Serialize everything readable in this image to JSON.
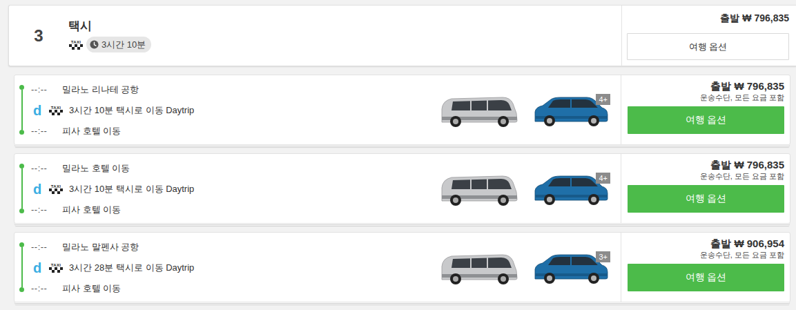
{
  "option": {
    "number": "3",
    "title": "택시",
    "taxi_label": "TAXI",
    "duration": "3시간 10분",
    "price": "출발 ₩ 796,835",
    "button": "여행 옵션"
  },
  "routes": [
    {
      "from_time": "--:--",
      "from": "밀라노 리나테 공항",
      "logo": "d",
      "taxi_label": "TAXI",
      "segment": "3시간 10분 택시로 이동 Daytrip",
      "to_time": "--:--",
      "to": "피사 호텔 이동",
      "capacity": "4+",
      "price": "출발 ₩ 796,835",
      "note": "운송수단, 모든 요금 포함",
      "button": "여행 옵션"
    },
    {
      "from_time": "--:--",
      "from": "밀라노 호텔 이동",
      "logo": "d",
      "taxi_label": "TAXI",
      "segment": "3시간 10분 택시로 이동 Daytrip",
      "to_time": "--:--",
      "to": "피사 호텔 이동",
      "capacity": "4+",
      "price": "출발 ₩ 796,835",
      "note": "운송수단, 모든 요금 포함",
      "button": "여행 옵션"
    },
    {
      "from_time": "--:--",
      "from": "밀라노 말펜사 공항",
      "logo": "d",
      "taxi_label": "TAXI",
      "segment": "3시간 28분 택시로 이동 Daytrip",
      "to_time": "--:--",
      "to": "피사 호텔 이동",
      "capacity": "3+",
      "price": "출발 ₩ 906,954",
      "note": "운송수단, 모든 요금 포함",
      "button": "여행 옵션"
    }
  ]
}
